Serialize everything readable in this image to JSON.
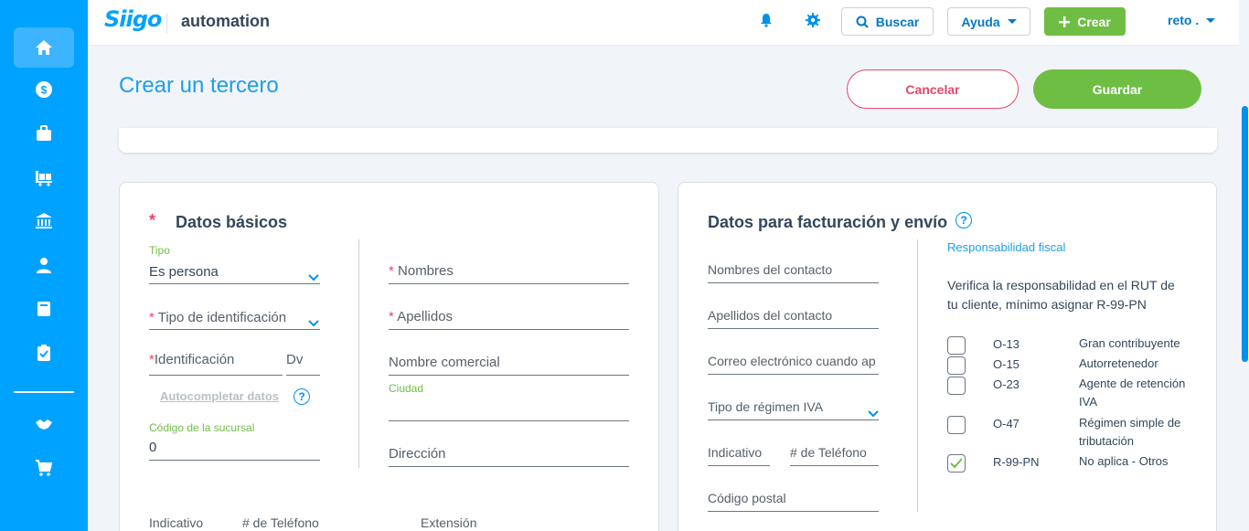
{
  "topbar": {
    "logo": "Siigo",
    "company": "automation",
    "search_label": "Buscar",
    "help_label": "Ayuda",
    "create_label": "Crear",
    "user_label": "reto ."
  },
  "sidebar": {
    "items": [
      "home-icon",
      "dollar-icon",
      "briefcase-icon",
      "inventory-icon",
      "bank-icon",
      "user-icon",
      "book-icon",
      "clipboard-icon",
      "handshake-icon",
      "cart-icon"
    ]
  },
  "header": {
    "title": "Crear un tercero",
    "cancel_label": "Cancelar",
    "save_label": "Guardar"
  },
  "basic": {
    "title": "Datos básicos",
    "asterisk": "*",
    "tipo_label": "Tipo",
    "tipo_value": "Es persona",
    "tipo_id_label": "Tipo de identificación",
    "identificacion_label": "Identificación",
    "dv_label": "Dv",
    "autocomplete_label": "Autocompletar datos",
    "sucursal_label": "Código de la sucursal",
    "sucursal_value": "0",
    "nombres_label": "Nombres",
    "apellidos_label": "Apellidos",
    "comercial_label": "Nombre comercial",
    "ciudad_label": "Ciudad",
    "direccion_label": "Dirección",
    "indicativo_label": "Indicativo",
    "telefono_label": "# de Teléfono",
    "extension_label": "Extensión"
  },
  "billing": {
    "title": "Datos para facturación y envío",
    "contacto_nombres": "Nombres del contacto",
    "contacto_apellidos": "Apellidos del contacto",
    "correo_label": "Correo electrónico cuando ap",
    "regimen_label": "Tipo de régimen IVA",
    "indicativo_label": "Indicativo",
    "telefono_label": "# de Teléfono",
    "postal_label": "Código postal",
    "resp_title": "Responsabilidad fiscal",
    "resp_note": "Verifica la responsabilidad en el RUT de tu cliente, mínimo asignar R-99-PN",
    "responsibilities": [
      {
        "code": "O-13",
        "desc": "Gran contribuyente",
        "checked": false
      },
      {
        "code": "O-15",
        "desc": "Autorretenedor",
        "checked": false
      },
      {
        "code": "O-23",
        "desc": "Agente de retención IVA",
        "checked": false
      },
      {
        "code": "O-47",
        "desc": "Régimen simple de tributación",
        "checked": false
      },
      {
        "code": "R-99-PN",
        "desc": "No aplica - Otros",
        "checked": true
      }
    ]
  },
  "colors": {
    "sidebar": "#00a2ff",
    "accent_green": "#6fbe44",
    "cancel_red": "#e5476a",
    "title_blue": "#1ea0e6"
  }
}
